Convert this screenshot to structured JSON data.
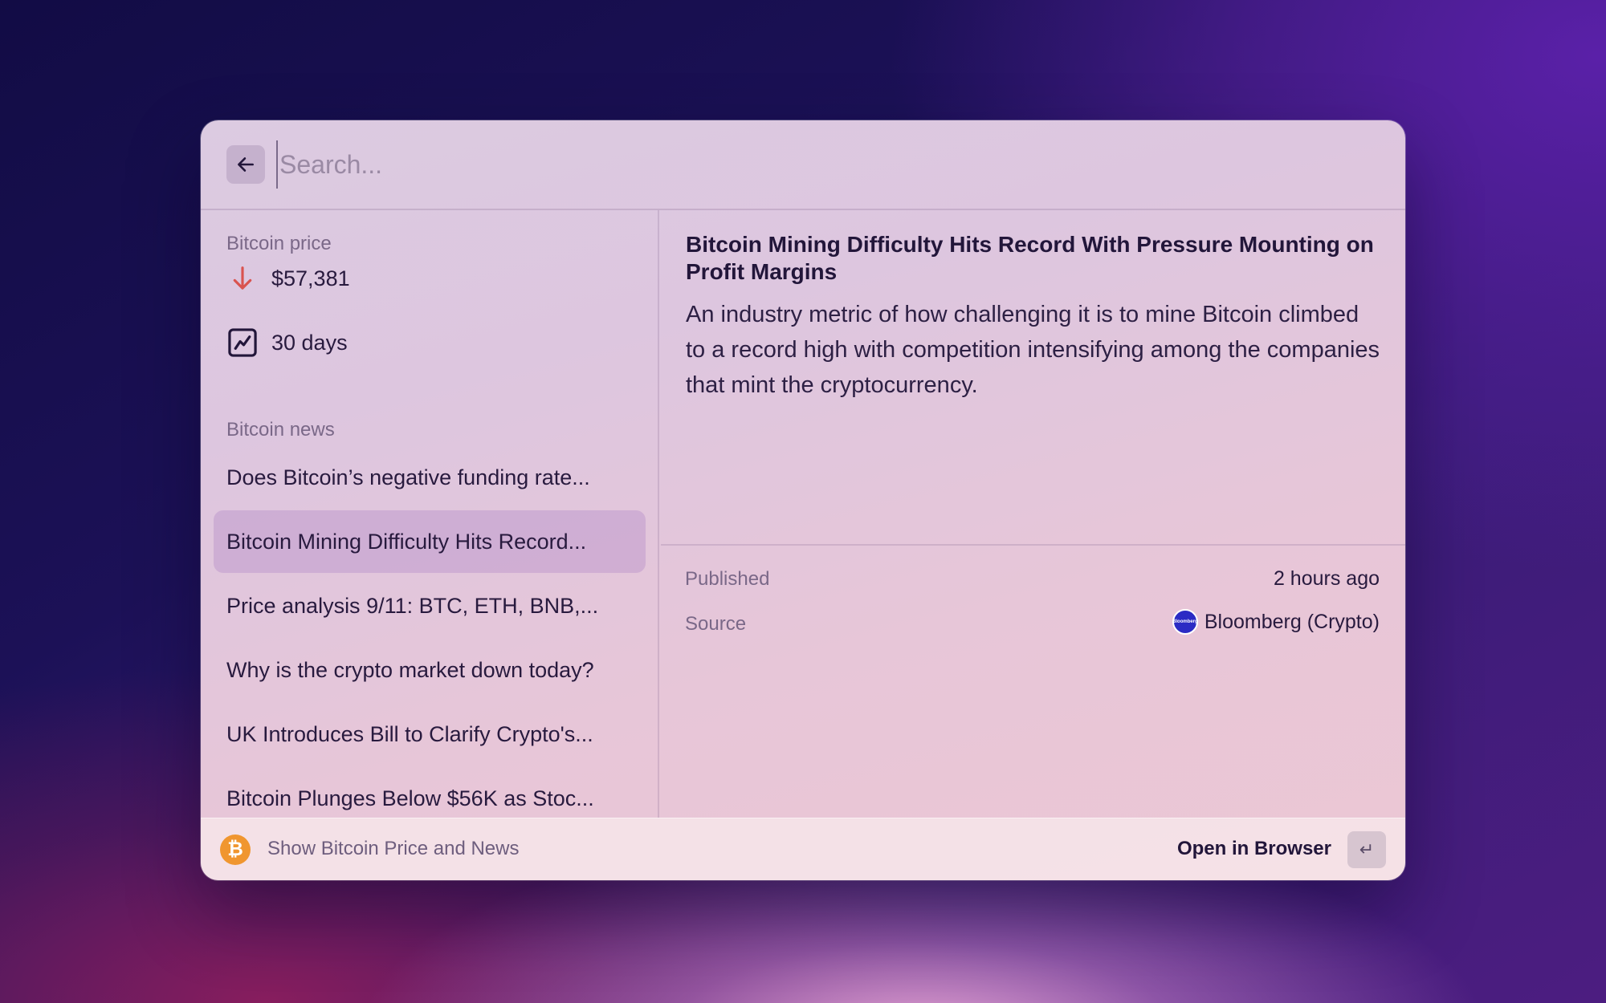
{
  "search": {
    "placeholder": "Search...",
    "value": ""
  },
  "icons": {
    "back": "arrow-left-icon",
    "price_down": "arrow-down-icon",
    "chart": "chart-line-icon",
    "bitcoin": "bitcoin-icon",
    "enter": "return-key-icon",
    "source_logo": "bloomberg-logo-icon"
  },
  "colors": {
    "price_down": "#d9534f",
    "bitcoin": "#f0962f",
    "selected_row": "#c9a6d8"
  },
  "sidebar": {
    "price_section": {
      "title": "Bitcoin price",
      "items": [
        {
          "label": "$57,381",
          "icon": "arrow-down-icon"
        },
        {
          "label": "30 days",
          "icon": "chart-line-icon"
        }
      ]
    },
    "news_section": {
      "title": "Bitcoin news",
      "items": [
        {
          "label": "Does Bitcoin’s negative funding rate...",
          "selected": false
        },
        {
          "label": "Bitcoin Mining Difficulty Hits Record...",
          "selected": true
        },
        {
          "label": "Price analysis 9/11: BTC, ETH, BNB,...",
          "selected": false
        },
        {
          "label": "Why is the crypto market down today?",
          "selected": false
        },
        {
          "label": "UK Introduces Bill to Clarify Crypto's...",
          "selected": false
        },
        {
          "label": "Bitcoin Plunges Below $56K as Stoc...",
          "selected": false
        }
      ]
    }
  },
  "detail": {
    "title": "Bitcoin Mining Difficulty Hits Record With Pressure Mounting on Profit Margins",
    "body": "An industry metric of how challenging it is to mine Bitcoin climbed to a record high with competition intensifying among the companies that mint the cryptocurrency.",
    "meta": {
      "published_label": "Published",
      "published_value": "2 hours ago",
      "source_label": "Source",
      "source_value": "Bloomberg (Crypto)",
      "source_logo_text": "Bloomberg"
    }
  },
  "footer": {
    "command_label": "Show Bitcoin Price and News",
    "bitcoin_glyph": "₿",
    "action_label": "Open in Browser",
    "enter_glyph": "↵"
  }
}
